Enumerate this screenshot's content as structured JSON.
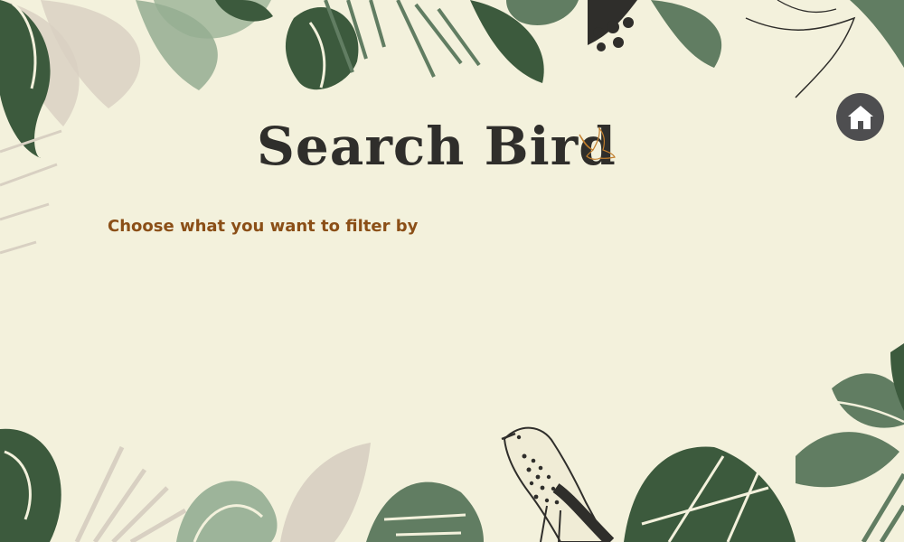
{
  "page": {
    "title": "Search Bird",
    "subtitle": "Choose what you want to filter by"
  },
  "icons": {
    "home": "home-icon",
    "title_bird": "flying-bird-icon"
  },
  "colors": {
    "background": "#f3f1dc",
    "title": "#2f2e2b",
    "subtitle": "#8b4f17",
    "home_button": "#4e4e50",
    "leaf_dark": "#3c5a3d",
    "leaf_mid": "#617d62",
    "leaf_light": "#94ad92",
    "leaf_beige": "#d8d0c2"
  }
}
